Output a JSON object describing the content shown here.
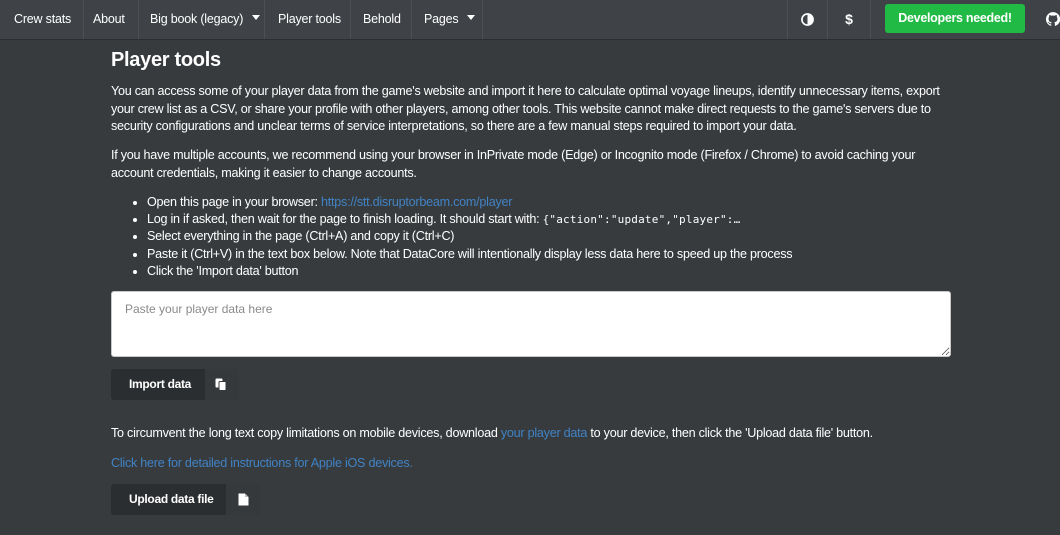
{
  "nav": {
    "items": [
      {
        "label": "Crew stats"
      },
      {
        "label": "About"
      },
      {
        "label": "Big book (legacy)"
      },
      {
        "label": "Player tools"
      },
      {
        "label": "Behold"
      },
      {
        "label": "Pages"
      }
    ],
    "theme_icon": "contrast-icon",
    "dollar_icon": "dollar-icon",
    "dollar_glyph": "$",
    "developers_button": "Developers needed!",
    "github_icon": "github-icon",
    "accent_color": "#21ba45"
  },
  "page": {
    "title": "Player tools",
    "intro": "You can access some of your player data from the game's website and import it here to calculate optimal voyage lineups, identify unnecessary items, export your crew list as a CSV, or share your profile with other players, among other tools. This website cannot make direct requests to the game's servers due to security configurations and unclear terms of service interpretations, so there are a few manual steps required to import your data.",
    "accounts_note": "If you have multiple accounts, we recommend using your browser in InPrivate mode (Edge) or Incognito mode (Firefox / Chrome) to avoid caching your account credentials, making it easier to change accounts.",
    "steps": {
      "step1_prefix": "Open this page in your browser: ",
      "step1_link": "https://stt.disruptorbeam.com/player",
      "step2_prefix": "Log in if asked, then wait for the page to finish loading. It should start with: ",
      "step2_code": "{\"action\":\"update\",\"player\":…",
      "step3": "Select everything in the page (Ctrl+A) and copy it (Ctrl+C)",
      "step4": "Paste it (Ctrl+V) in the text box below. Note that DataCore will intentionally display less data here to speed up the process",
      "step5": "Click the 'Import data' button"
    },
    "textarea_placeholder": "Paste your player data here",
    "textarea_value": "",
    "import_button": "Import data",
    "mobile_prefix": "To circumvent the long text copy limitations on mobile devices, download ",
    "mobile_link": "your player data",
    "mobile_suffix": " to your device, then click the 'Upload data file' button.",
    "ios_link": "Click here for detailed instructions for Apple iOS devices.",
    "upload_button": "Upload data file",
    "link_color": "#4183c4"
  }
}
